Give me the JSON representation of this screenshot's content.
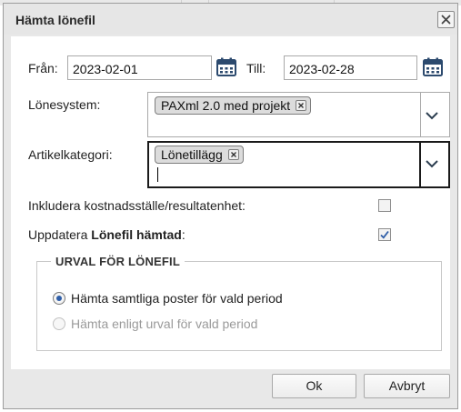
{
  "dialog": {
    "title": "Hämta lönefil",
    "close_icon": "close-icon"
  },
  "period": {
    "from_label": "Från:",
    "from_value": "2023-02-01",
    "to_label": "Till:",
    "to_value": "2023-02-28",
    "calendar_icon": "calendar-icon"
  },
  "lonesystem": {
    "label": "Lönesystem:",
    "tags": [
      "PAXml 2.0 med projekt"
    ],
    "dropdown_icon": "chevron-down-icon"
  },
  "artikelkategori": {
    "label": "Artikelkategori:",
    "tags": [
      "Lönetillägg"
    ],
    "dropdown_icon": "chevron-down-icon"
  },
  "options": {
    "include_cost_label": "Inkludera kostnadsställe/resultatenhet:",
    "include_cost_checked": false,
    "update_label_prefix": "Uppdatera ",
    "update_label_bold": "Lönefil hämtad",
    "update_label_suffix": ":",
    "update_checked": true
  },
  "selection": {
    "legend": "URVAL FÖR LÖNEFIL",
    "radios": [
      {
        "label": "Hämta samtliga poster för vald period",
        "checked": true,
        "disabled": false
      },
      {
        "label": "Hämta enligt urval för vald period",
        "checked": false,
        "disabled": true
      }
    ]
  },
  "footer": {
    "ok_label": "Ok",
    "cancel_label": "Avbryt"
  },
  "colors": {
    "accent": "#2f5ea8",
    "calendar_icon": "#2c4a6e",
    "chrome": "#e8e8e8"
  }
}
